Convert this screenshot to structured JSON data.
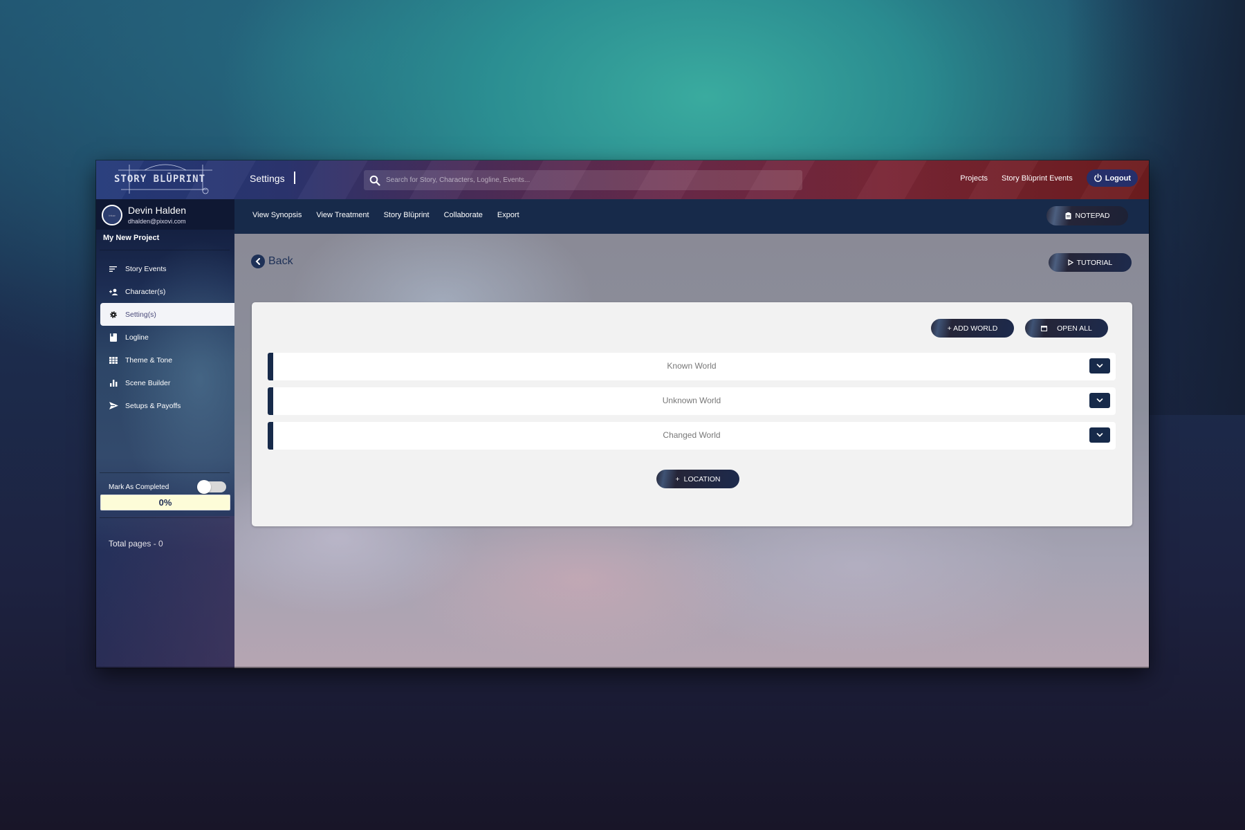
{
  "app": {
    "logo_text": "STORY BLŪPRINT",
    "page_title": "Settings"
  },
  "search": {
    "placeholder": "Search for Story, Characters, Logline, Events...",
    "value": ""
  },
  "top_links": {
    "projects": "Projects",
    "events": "Story Blūprint Events",
    "logout": "Logout"
  },
  "subnav": {
    "items": [
      {
        "label": "View Synopsis"
      },
      {
        "label": "View Treatment"
      },
      {
        "label": "Story Blūprint"
      },
      {
        "label": "Collaborate"
      },
      {
        "label": "Export"
      }
    ],
    "notepad": "NOTEPAD"
  },
  "user": {
    "name": "Devin Halden",
    "email": "dhalden@pixovi.com",
    "avatar_text": "intuw"
  },
  "sidebar": {
    "project": "My New Project",
    "items": [
      {
        "label": "Story Events",
        "icon": "sort-lines-icon",
        "active": false
      },
      {
        "label": "Character(s)",
        "icon": "add-person-icon",
        "active": false
      },
      {
        "label": "Setting(s)",
        "icon": "gear-icon",
        "active": true
      },
      {
        "label": "Logline",
        "icon": "book-icon",
        "active": false
      },
      {
        "label": "Theme & Tone",
        "icon": "grid-icon",
        "active": false
      },
      {
        "label": "Scene Builder",
        "icon": "bar-chart-icon",
        "active": false
      },
      {
        "label": "Setups & Payoffs",
        "icon": "send-icon",
        "active": false
      }
    ],
    "mark_completed": "Mark As Completed",
    "mark_completed_on": false,
    "progress_percent": 0,
    "progress_label": "0%",
    "total_pages": "Total pages - 0"
  },
  "main": {
    "back_label": "Back",
    "tutorial_label": "TUTORIAL",
    "add_world_label": "+ ADD WORLD",
    "open_all_label": "OPEN ALL",
    "worlds": [
      {
        "label": "Known World"
      },
      {
        "label": "Unknown World"
      },
      {
        "label": "Changed World"
      }
    ],
    "location_label": "LOCATION"
  },
  "colors": {
    "navy": "#172a4a",
    "logout_bg": "#252f6a",
    "progress_bg": "#fdfcd8",
    "panel_bg": "#f2f2f2"
  }
}
